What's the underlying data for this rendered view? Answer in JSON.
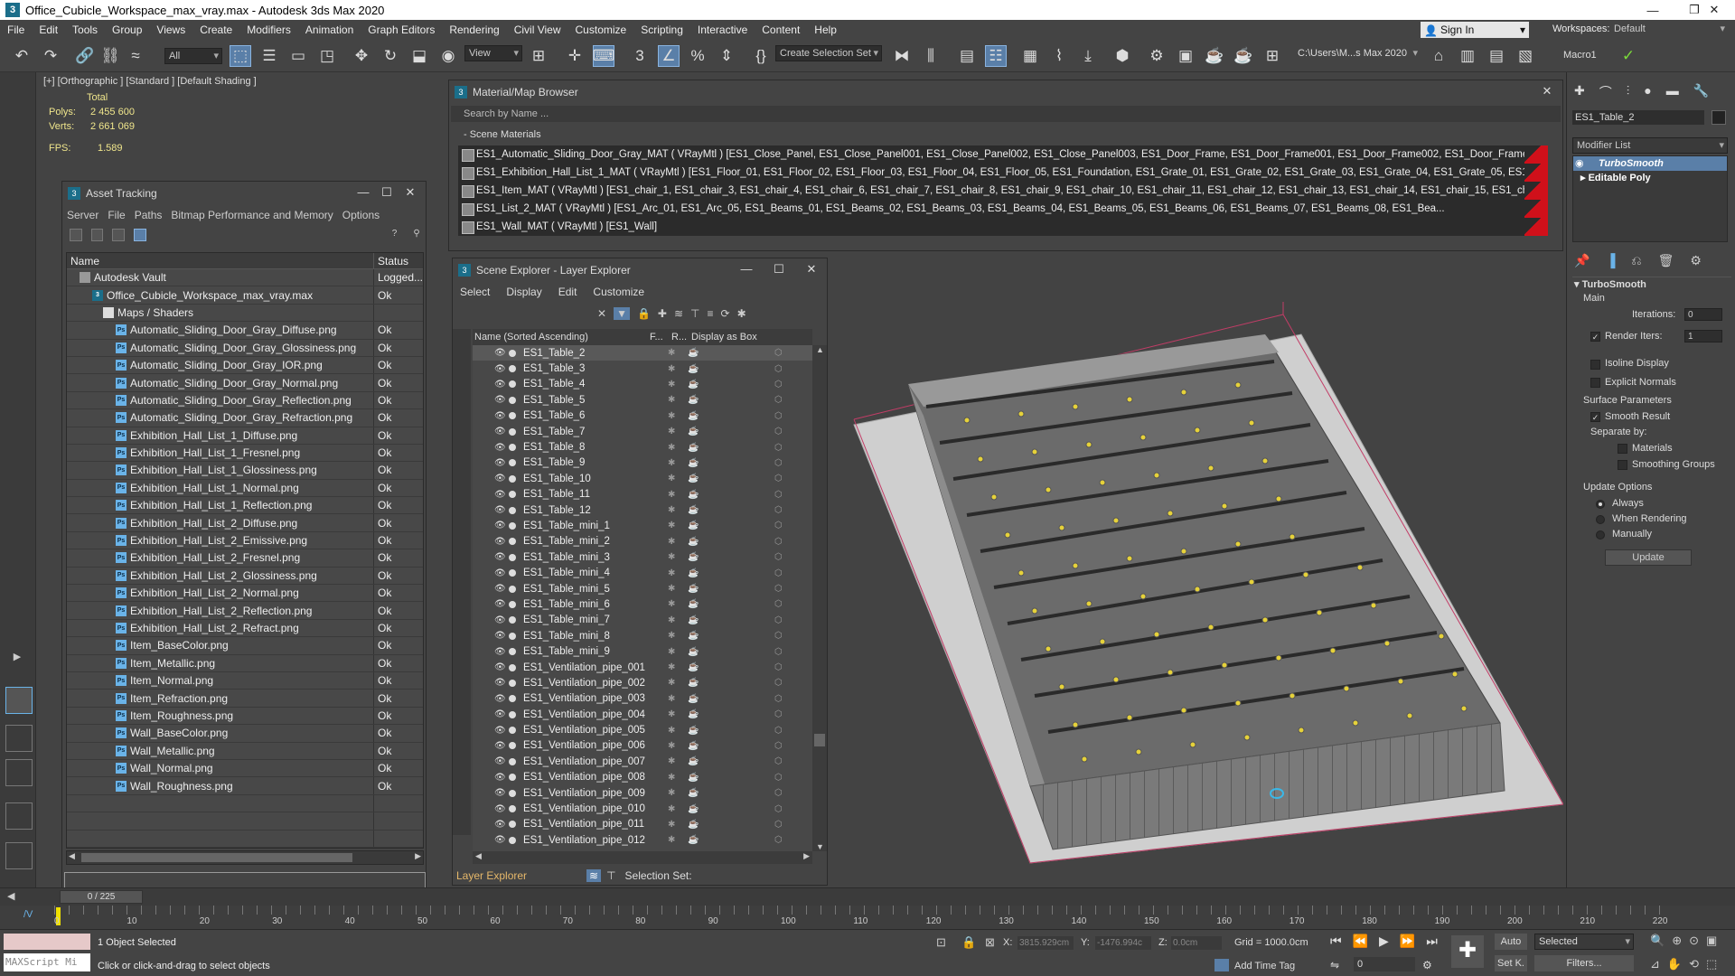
{
  "window": {
    "title": "Office_Cubicle_Workspace_max_vray.max - Autodesk 3ds Max 2020"
  },
  "menu": [
    "File",
    "Edit",
    "Tools",
    "Group",
    "Views",
    "Create",
    "Modifiers",
    "Animation",
    "Graph Editors",
    "Rendering",
    "Civil View",
    "Customize",
    "Scripting",
    "Interactive",
    "Content",
    "Help"
  ],
  "account": {
    "signin": "Sign In",
    "workspaces_label": "Workspaces:",
    "workspace": "Default"
  },
  "toolbar": {
    "filter": "All",
    "view": "View",
    "selection_set": "Create Selection Set",
    "path": "C:\\Users\\M...s Max 2020",
    "macro": "Macro1"
  },
  "viewport": {
    "label": "[+] [Orthographic ] [Standard ] [Default Shading ]",
    "stats": {
      "total_label": "Total",
      "polys_label": "Polys:",
      "polys": "2 455 600",
      "verts_label": "Verts:",
      "verts": "2 661 069",
      "fps_label": "FPS:",
      "fps": "1.589"
    }
  },
  "asset_tracking": {
    "title": "Asset Tracking",
    "menu": [
      "Server",
      "File",
      "Paths",
      "Bitmap Performance and Memory",
      "Options"
    ],
    "col_name": "Name",
    "col_status": "Status",
    "rows": [
      {
        "name": "Autodesk Vault",
        "status": "Logged...",
        "indent": 1,
        "kind": "vault"
      },
      {
        "name": "Office_Cubicle_Workspace_max_vray.max",
        "status": "Ok",
        "indent": 2,
        "kind": "max"
      },
      {
        "name": "Maps / Shaders",
        "status": "",
        "indent": 3,
        "kind": "folder"
      },
      {
        "name": "Automatic_Sliding_Door_Gray_Diffuse.png",
        "status": "Ok",
        "indent": 4,
        "kind": "ps"
      },
      {
        "name": "Automatic_Sliding_Door_Gray_Glossiness.png",
        "status": "Ok",
        "indent": 4,
        "kind": "ps"
      },
      {
        "name": "Automatic_Sliding_Door_Gray_IOR.png",
        "status": "Ok",
        "indent": 4,
        "kind": "ps"
      },
      {
        "name": "Automatic_Sliding_Door_Gray_Normal.png",
        "status": "Ok",
        "indent": 4,
        "kind": "ps"
      },
      {
        "name": "Automatic_Sliding_Door_Gray_Reflection.png",
        "status": "Ok",
        "indent": 4,
        "kind": "ps"
      },
      {
        "name": "Automatic_Sliding_Door_Gray_Refraction.png",
        "status": "Ok",
        "indent": 4,
        "kind": "ps"
      },
      {
        "name": "Exhibition_Hall_List_1_Diffuse.png",
        "status": "Ok",
        "indent": 4,
        "kind": "ps"
      },
      {
        "name": "Exhibition_Hall_List_1_Fresnel.png",
        "status": "Ok",
        "indent": 4,
        "kind": "ps"
      },
      {
        "name": "Exhibition_Hall_List_1_Glossiness.png",
        "status": "Ok",
        "indent": 4,
        "kind": "ps"
      },
      {
        "name": "Exhibition_Hall_List_1_Normal.png",
        "status": "Ok",
        "indent": 4,
        "kind": "ps"
      },
      {
        "name": "Exhibition_Hall_List_1_Reflection.png",
        "status": "Ok",
        "indent": 4,
        "kind": "ps"
      },
      {
        "name": "Exhibition_Hall_List_2_Diffuse.png",
        "status": "Ok",
        "indent": 4,
        "kind": "ps"
      },
      {
        "name": "Exhibition_Hall_List_2_Emissive.png",
        "status": "Ok",
        "indent": 4,
        "kind": "ps"
      },
      {
        "name": "Exhibition_Hall_List_2_Fresnel.png",
        "status": "Ok",
        "indent": 4,
        "kind": "ps"
      },
      {
        "name": "Exhibition_Hall_List_2_Glossiness.png",
        "status": "Ok",
        "indent": 4,
        "kind": "ps"
      },
      {
        "name": "Exhibition_Hall_List_2_Normal.png",
        "status": "Ok",
        "indent": 4,
        "kind": "ps"
      },
      {
        "name": "Exhibition_Hall_List_2_Reflection.png",
        "status": "Ok",
        "indent": 4,
        "kind": "ps"
      },
      {
        "name": "Exhibition_Hall_List_2_Refract.png",
        "status": "Ok",
        "indent": 4,
        "kind": "ps"
      },
      {
        "name": "Item_BaseColor.png",
        "status": "Ok",
        "indent": 4,
        "kind": "ps"
      },
      {
        "name": "Item_Metallic.png",
        "status": "Ok",
        "indent": 4,
        "kind": "ps"
      },
      {
        "name": "Item_Normal.png",
        "status": "Ok",
        "indent": 4,
        "kind": "ps"
      },
      {
        "name": "Item_Refraction.png",
        "status": "Ok",
        "indent": 4,
        "kind": "ps"
      },
      {
        "name": "Item_Roughness.png",
        "status": "Ok",
        "indent": 4,
        "kind": "ps"
      },
      {
        "name": "Wall_BaseColor.png",
        "status": "Ok",
        "indent": 4,
        "kind": "ps"
      },
      {
        "name": "Wall_Metallic.png",
        "status": "Ok",
        "indent": 4,
        "kind": "ps"
      },
      {
        "name": "Wall_Normal.png",
        "status": "Ok",
        "indent": 4,
        "kind": "ps"
      },
      {
        "name": "Wall_Roughness.png",
        "status": "Ok",
        "indent": 4,
        "kind": "ps"
      }
    ]
  },
  "material_browser": {
    "title": "Material/Map Browser",
    "search_placeholder": "Search by Name ...",
    "section": "- Scene Materials",
    "materials": [
      "ES1_Automatic_Sliding_Door_Gray_MAT  ( VRayMtl )  [ES1_Close_Panel, ES1_Close_Panel001, ES1_Close_Panel002, ES1_Close_Panel003, ES1_Door_Frame, ES1_Door_Frame001, ES1_Door_Frame002, ES1_Door_Frame003, ES1_Lock, ES1...",
      "ES1_Exhibition_Hall_List_1_MAT  ( VRayMtl )  [ES1_Floor_01, ES1_Floor_02, ES1_Floor_03, ES1_Floor_04, ES1_Floor_05, ES1_Foundation, ES1_Grate_01, ES1_Grate_02, ES1_Grate_03, ES1_Grate_04, ES1_Grate_05, ES1_Grate_06, ES1_Gra...",
      "ES1_Item_MAT  ( VRayMtl )  [ES1_chair_1, ES1_chair_3, ES1_chair_4, ES1_chair_6, ES1_chair_7, ES1_chair_8, ES1_chair_9, ES1_chair_10, ES1_chair_11, ES1_chair_12, ES1_chair_13, ES1_chair_14, ES1_chair_15, ES1_chair_16, ES1_chair...",
      "ES1_List_2_MAT  ( VRayMtl )  [ES1_Arc_01, ES1_Arc_05, ES1_Beams_01, ES1_Beams_02, ES1_Beams_03, ES1_Beams_04, ES1_Beams_05, ES1_Beams_06, ES1_Beams_07, ES1_Beams_08, ES1_Bea...",
      "ES1_Wall_MAT  ( VRayMtl )  [ES1_Wall]"
    ]
  },
  "scene_explorer": {
    "title": "Scene Explorer - Layer Explorer",
    "menu": [
      "Select",
      "Display",
      "Edit",
      "Customize"
    ],
    "col_name": "Name (Sorted Ascending)",
    "col_f": "F...",
    "col_r": "R...",
    "col_box": "Display as Box",
    "items": [
      "ES1_Table_2",
      "ES1_Table_3",
      "ES1_Table_4",
      "ES1_Table_5",
      "ES1_Table_6",
      "ES1_Table_7",
      "ES1_Table_8",
      "ES1_Table_9",
      "ES1_Table_10",
      "ES1_Table_11",
      "ES1_Table_12",
      "ES1_Table_mini_1",
      "ES1_Table_mini_2",
      "ES1_Table_mini_3",
      "ES1_Table_mini_4",
      "ES1_Table_mini_5",
      "ES1_Table_mini_6",
      "ES1_Table_mini_7",
      "ES1_Table_mini_8",
      "ES1_Table_mini_9",
      "ES1_Ventilation_pipe_001",
      "ES1_Ventilation_pipe_002",
      "ES1_Ventilation_pipe_003",
      "ES1_Ventilation_pipe_004",
      "ES1_Ventilation_pipe_005",
      "ES1_Ventilation_pipe_006",
      "ES1_Ventilation_pipe_007",
      "ES1_Ventilation_pipe_008",
      "ES1_Ventilation_pipe_009",
      "ES1_Ventilation_pipe_010",
      "ES1_Ventilation_pipe_011",
      "ES1_Ventilation_pipe_012"
    ],
    "footer_layer": "Layer Explorer",
    "footer_selset": "Selection Set:"
  },
  "command_panel": {
    "object_name": "ES1_Table_2",
    "modifier_list": "Modifier List",
    "stack": [
      "TurboSmooth",
      "Editable Poly"
    ],
    "turbosmooth": {
      "title": "TurboSmooth",
      "main": "Main",
      "iterations_label": "Iterations:",
      "iterations": "0",
      "render_iters_label": "Render Iters:",
      "render_iters": "1",
      "isoline": "Isoline Display",
      "explicit": "Explicit Normals",
      "surface": "Surface Parameters",
      "smooth_result": "Smooth Result",
      "separate": "Separate by:",
      "materials": "Materials",
      "smoothing": "Smoothing Groups",
      "update_options": "Update Options",
      "always": "Always",
      "when_rendering": "When Rendering",
      "manually": "Manually",
      "update_btn": "Update"
    }
  },
  "timeline": {
    "frame": "0 / 225",
    "ticks": [
      "0",
      "10",
      "20",
      "30",
      "40",
      "50",
      "60",
      "70",
      "80",
      "90",
      "100",
      "110",
      "120",
      "130",
      "140",
      "150",
      "160",
      "170",
      "180",
      "190",
      "200",
      "210",
      "220"
    ]
  },
  "status": {
    "maxscript": "MAXScript Mi",
    "selected": "1 Object Selected",
    "prompt": "Click or click-and-drag to select objects",
    "x_label": "X:",
    "x": "3815.929cm",
    "y_label": "Y:",
    "y": "-1476.994c",
    "z_label": "Z:",
    "z": "0.0cm",
    "grid": "Grid = 1000.0cm",
    "add_time_tag": "Add Time Tag",
    "auto": "Auto",
    "selected_dd": "Selected",
    "setk": "Set K.",
    "filters": "Filters...",
    "frame_field": "0"
  }
}
